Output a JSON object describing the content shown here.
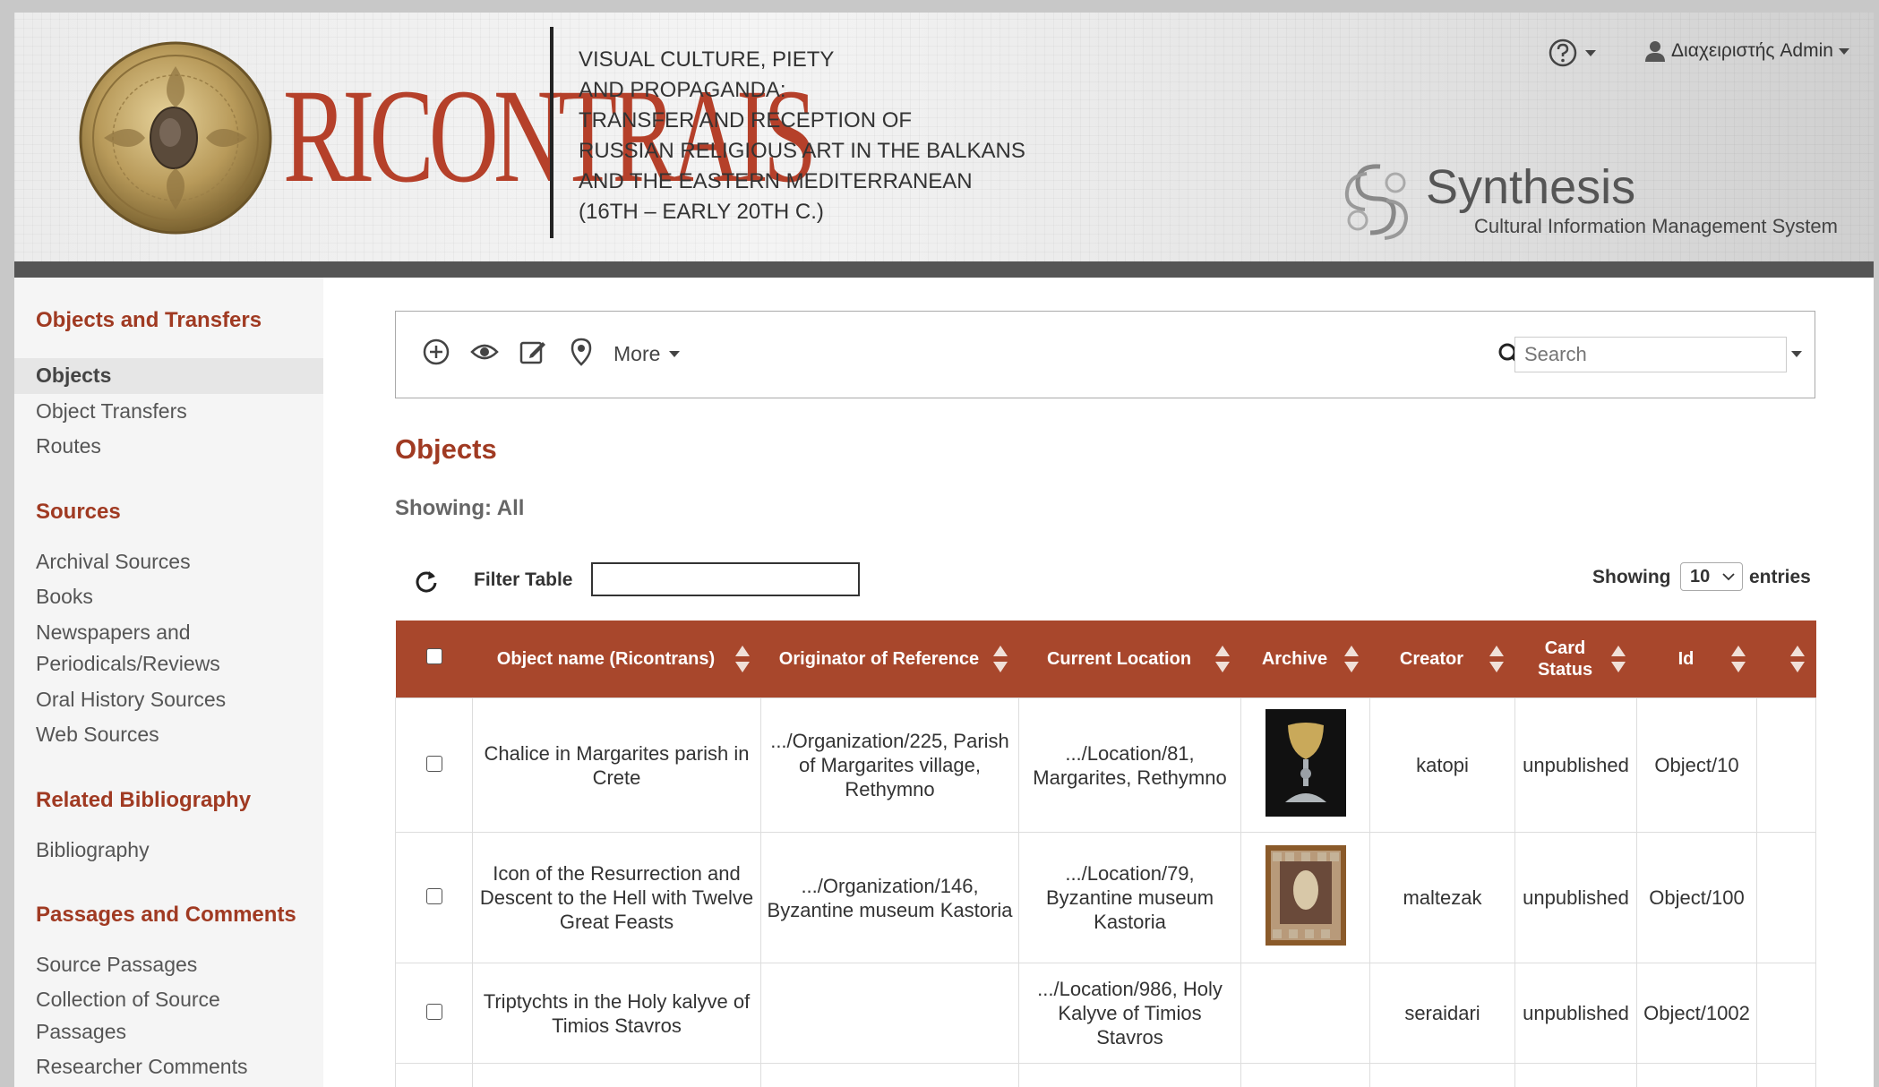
{
  "header": {
    "brand": "RICONTRAIS",
    "title_lines": [
      "VISUAL CULTURE, PIETY",
      "AND PROPAGANDA:",
      "TRANSFER AND RECEPTION OF",
      "RUSSIAN RELIGIOUS ART IN THE BALKANS",
      "AND THE EASTERN MEDITERRANEAN",
      "(16TH – EARLY 20TH C.)"
    ],
    "user_name": "Διαχειριστής Admin",
    "synthesis_name": "Synthesis",
    "synthesis_sub": "Cultural Information Management System"
  },
  "sidebar": {
    "sections": [
      {
        "heading": "Objects and Transfers",
        "items": [
          "Objects",
          "Object Transfers",
          "Routes"
        ]
      },
      {
        "heading": "Sources",
        "items": [
          "Archival Sources",
          "Books",
          "Newspapers and",
          "Periodicals/Reviews",
          "Oral History Sources",
          "Web Sources"
        ]
      },
      {
        "heading": "Related Bibliography",
        "items": [
          "Bibliography"
        ]
      },
      {
        "heading": "Passages and Comments",
        "items": [
          "Source Passages",
          "Collection of Source",
          "Passages",
          "Researcher Comments"
        ]
      }
    ],
    "active_item": "Objects"
  },
  "toolbar": {
    "more_label": "More",
    "search_placeholder": "Search"
  },
  "page": {
    "title": "Objects",
    "showing": "Showing: All",
    "filter_label": "Filter Table",
    "showing_label": "Showing",
    "entries_value": "10",
    "entries_label": "entries"
  },
  "table": {
    "columns": [
      "Object name (Ricontrans)",
      "Originator of Reference",
      "Current Location",
      "Archive",
      "Creator",
      "Card Status",
      "Id",
      ""
    ],
    "rows": [
      {
        "name": "Chalice in Margarites parish in Crete",
        "originator": ".../Organization/225, Parish of Margarites village, Rethymno",
        "location": ".../Location/81, Margarites, Rethymno",
        "archive": "chalice-image",
        "creator": "katopi",
        "status": "unpublished",
        "id": "Object/10"
      },
      {
        "name": "Icon of the Resurrection and Descent to the Hell with Twelve Great Feasts",
        "originator": ".../Organization/146, Byzantine museum Kastoria",
        "location": ".../Location/79, Byzantine museum Kastoria",
        "archive": "icon-image",
        "creator": "maltezak",
        "status": "unpublished",
        "id": "Object/100"
      },
      {
        "name": "Triptychts in the Holy kalyve of Timios Stavros",
        "originator": "",
        "location": ".../Location/986, Holy Kalyve of Timios Stavros",
        "archive": "",
        "creator": "seraidari",
        "status": "unpublished",
        "id": "Object/1002"
      }
    ]
  },
  "colors": {
    "accent": "#a03a22",
    "table_header": "#a8472c",
    "brand_red": "#b5402a"
  }
}
